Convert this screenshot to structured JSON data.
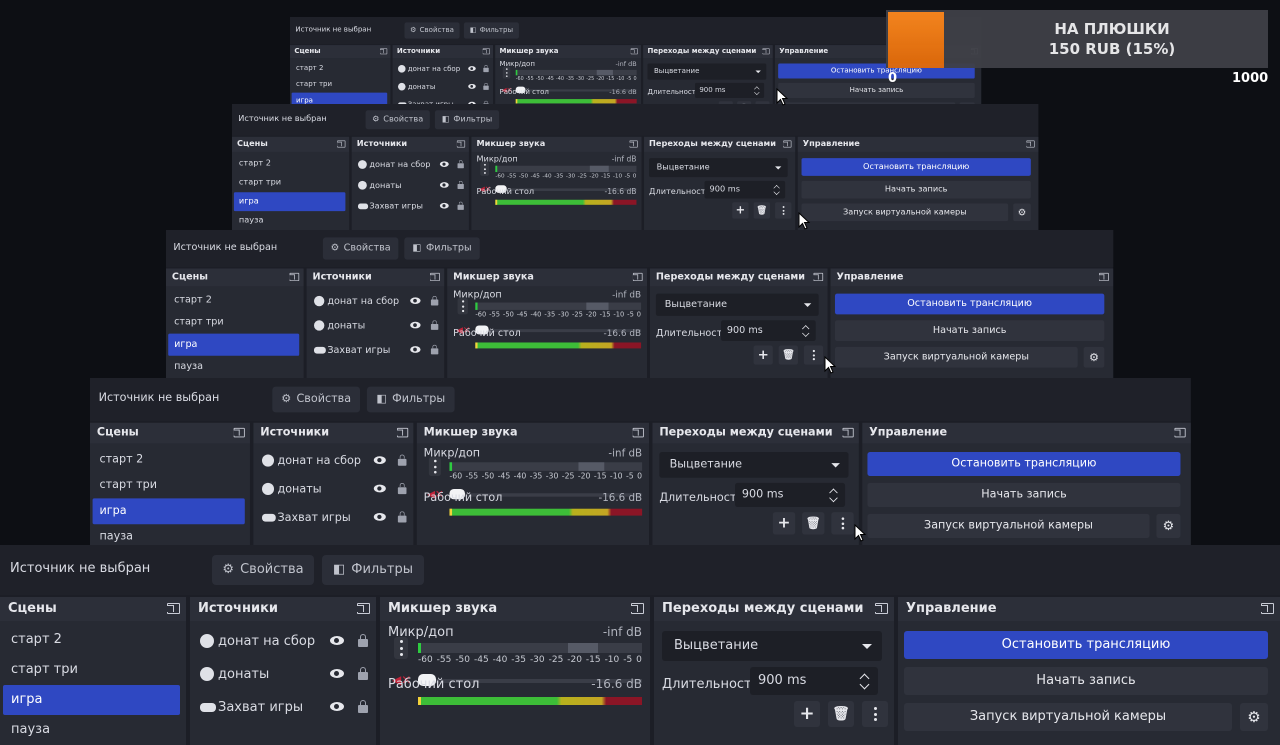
{
  "source_bar": {
    "label": "Источник не выбран",
    "properties": "Свойства",
    "filters": "Фильтры"
  },
  "scenes": {
    "title": "Сцены",
    "items": [
      "старт 2",
      "старт три",
      "игра",
      "пауза"
    ],
    "selected": "игра"
  },
  "sources": {
    "title": "Источники",
    "items": [
      "донат на сбор",
      "донаты",
      "Захват игры"
    ]
  },
  "mixer": {
    "title": "Микшер звука",
    "mic": {
      "name": "Микр/доп",
      "db": "-inf dB"
    },
    "desktop": {
      "name": "Рабочий стол",
      "db": "-16.6 dB"
    },
    "ticks": [
      "-60",
      "-55",
      "-50",
      "-45",
      "-40",
      "-35",
      "-30",
      "-25",
      "-20",
      "-15",
      "-10",
      "-5",
      "0"
    ]
  },
  "transitions": {
    "title": "Переходы между сценами",
    "selected": "Выцветание",
    "duration_label": "Длительность",
    "duration_value": "900 ms"
  },
  "controls": {
    "title": "Управление",
    "stop_stream": "Остановить трансляцию",
    "start_record": "Начать запись",
    "virtual_cam": "Запуск виртуальной камеры"
  },
  "donation_alert": {
    "line1": "НА ПЛЮШКИ",
    "line2": "150 RUB (15%)",
    "goal_min": "0",
    "goal_max": "1000"
  },
  "colors": {
    "accent": "#2f48c2",
    "alert_bar": "#f07a10"
  }
}
